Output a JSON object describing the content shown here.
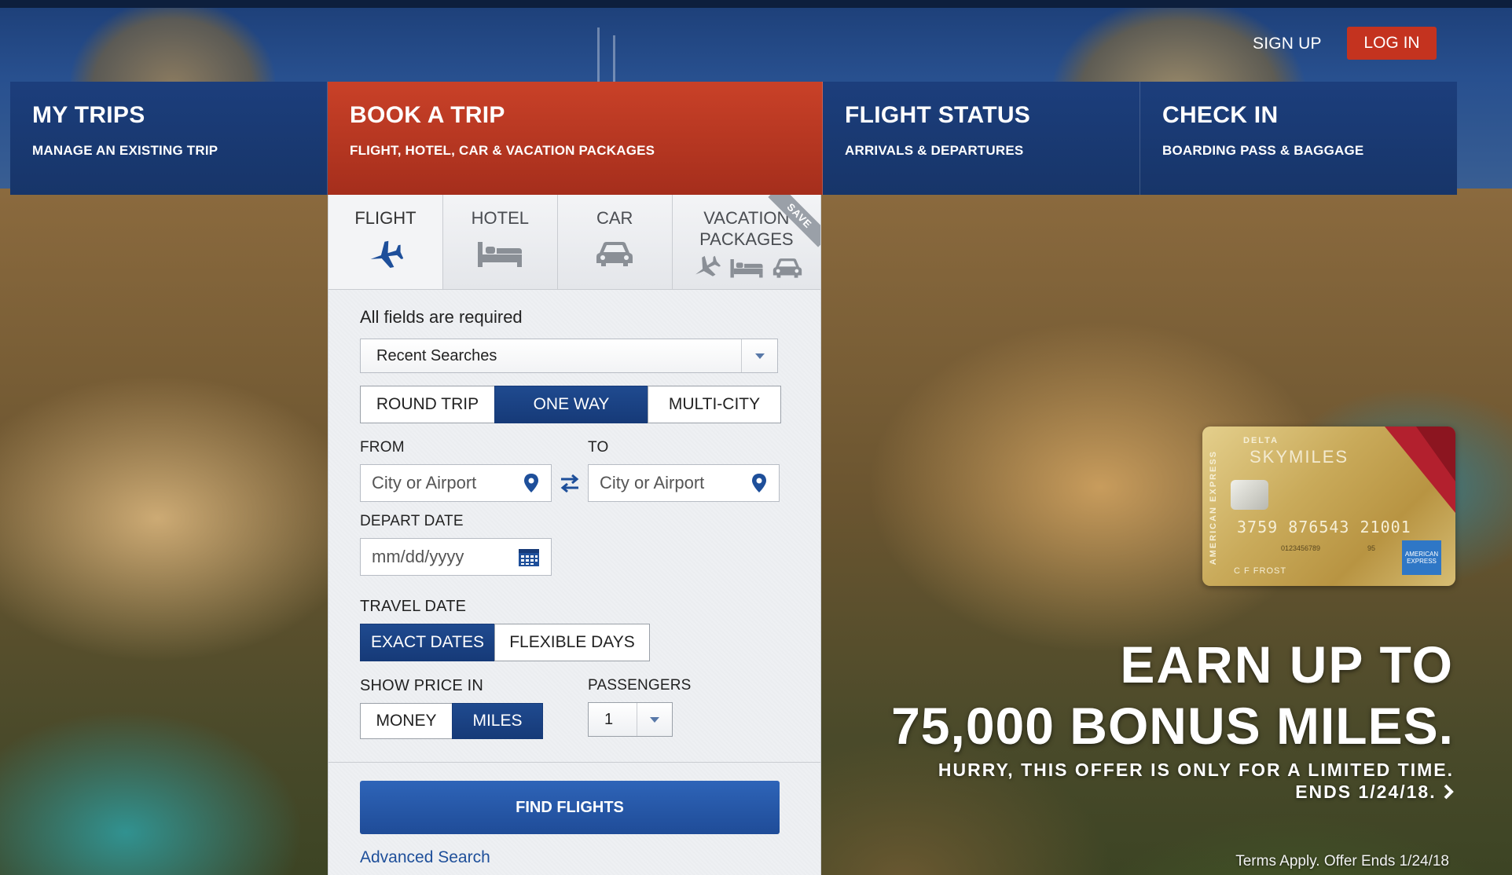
{
  "header": {
    "sign_up": "SIGN UP",
    "log_in": "LOG IN"
  },
  "nav": [
    {
      "title": "MY TRIPS",
      "subtitle": "MANAGE AN EXISTING TRIP"
    },
    {
      "title": "BOOK A TRIP",
      "subtitle": "FLIGHT, HOTEL, CAR & VACATION PACKAGES"
    },
    {
      "title": "FLIGHT STATUS",
      "subtitle": "ARRIVALS & DEPARTURES"
    },
    {
      "title": "CHECK IN",
      "subtitle": "BOARDING PASS & BAGGAGE"
    }
  ],
  "tabs": {
    "flight": "FLIGHT",
    "hotel": "HOTEL",
    "car": "CAR",
    "vacation_line1": "VACATION",
    "vacation_line2": "PACKAGES",
    "save_ribbon": "SAVE"
  },
  "form": {
    "required_note": "All fields are required",
    "recent_searches": "Recent Searches",
    "trip_types": [
      "ROUND TRIP",
      "ONE WAY",
      "MULTI-CITY"
    ],
    "selected_trip_type": "ONE WAY",
    "from_label": "FROM",
    "to_label": "TO",
    "from_placeholder": "City or Airport",
    "to_placeholder": "City or Airport",
    "depart_label": "DEPART DATE",
    "depart_placeholder": "mm/dd/yyyy",
    "travel_date_label": "TRAVEL DATE",
    "travel_date_options": [
      "EXACT DATES",
      "FLEXIBLE DAYS"
    ],
    "selected_travel_date": "EXACT DATES",
    "price_label": "SHOW PRICE IN",
    "price_options": [
      "MONEY",
      "MILES"
    ],
    "selected_price": "MILES",
    "passengers_label": "PASSENGERS",
    "passengers_value": "1",
    "find_button": "FIND FLIGHTS",
    "advanced_search": "Advanced Search"
  },
  "promo": {
    "headline1": "EARN UP TO",
    "headline2": "75,000 BONUS MILES.",
    "sub1": "HURRY, THIS OFFER IS ONLY FOR A LIMITED TIME.",
    "sub2": "ENDS 1/24/18.",
    "terms": "Terms Apply. Offer Ends 1/24/18",
    "card": {
      "delta": "DELTA",
      "brand": "SKYMILES",
      "issuer_side": "AMERICAN EXPRESS",
      "number": "3759 876543 21001",
      "account": "0123456789",
      "expiry": "95",
      "owner": "C F FROST",
      "badge": "AMERICAN EXPRESS"
    }
  },
  "colors": {
    "nav_blue": "#1c3e7c",
    "nav_active_red": "#c94128",
    "selected_blue": "#163a78",
    "login_red": "#c4331f",
    "find_button_blue": "#2e64b8",
    "link_blue": "#1e4f9a"
  },
  "icons": {
    "flight": "airplane-icon",
    "hotel": "bed-icon",
    "car": "car-icon",
    "location": "map-pin-icon",
    "swap": "swap-arrows-icon",
    "calendar": "calendar-icon",
    "dropdown": "chevron-down-icon",
    "more": "chevron-right-icon"
  }
}
